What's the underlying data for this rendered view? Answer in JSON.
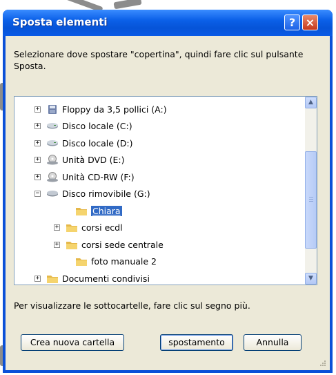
{
  "window": {
    "title": "Sposta elementi"
  },
  "titlebar": {
    "help_label": "?",
    "close_label": "×"
  },
  "prompt": "Selezionare dove spostare \"copertina\", quindi fare clic sul pulsante Sposta.",
  "tree": {
    "items": [
      {
        "label": "Floppy da 3,5 pollici (A:)",
        "icon": "floppy-drive-icon",
        "expander": "+",
        "selected": false
      },
      {
        "label": "Disco locale (C:)",
        "icon": "hard-disk-icon",
        "expander": "+",
        "selected": false
      },
      {
        "label": "Disco locale (D:)",
        "icon": "hard-disk-icon",
        "expander": "+",
        "selected": false
      },
      {
        "label": "Unità DVD (E:)",
        "icon": "dvd-drive-icon",
        "expander": "+",
        "selected": false
      },
      {
        "label": "Unità CD-RW (F:)",
        "icon": "cd-drive-icon",
        "expander": "+",
        "selected": false
      },
      {
        "label": "Disco rimovibile (G:)",
        "icon": "removable-disk-icon",
        "expander": "−",
        "selected": false
      },
      {
        "label": "Chiara",
        "icon": "folder-icon",
        "expander": "",
        "selected": true
      },
      {
        "label": "corsi ecdl",
        "icon": "folder-icon",
        "expander": "+",
        "selected": false
      },
      {
        "label": "corsi sede centrale",
        "icon": "folder-icon",
        "expander": "+",
        "selected": false
      },
      {
        "label": "foto manuale 2",
        "icon": "folder-icon",
        "expander": "",
        "selected": false
      },
      {
        "label": "Documenti condivisi",
        "icon": "folder-icon",
        "expander": "+",
        "selected": false
      }
    ]
  },
  "hint": "Per visualizzare le sottocartelle, fare clic sul segno più.",
  "buttons": {
    "new_folder": "Crea nuova cartella",
    "move": "spostamento",
    "cancel": "Annulla"
  },
  "colors": {
    "title_bar": "#0a5ae6",
    "selection": "#316ac5",
    "dialog_bg": "#ece9d8",
    "folder": "#f5d46e"
  }
}
